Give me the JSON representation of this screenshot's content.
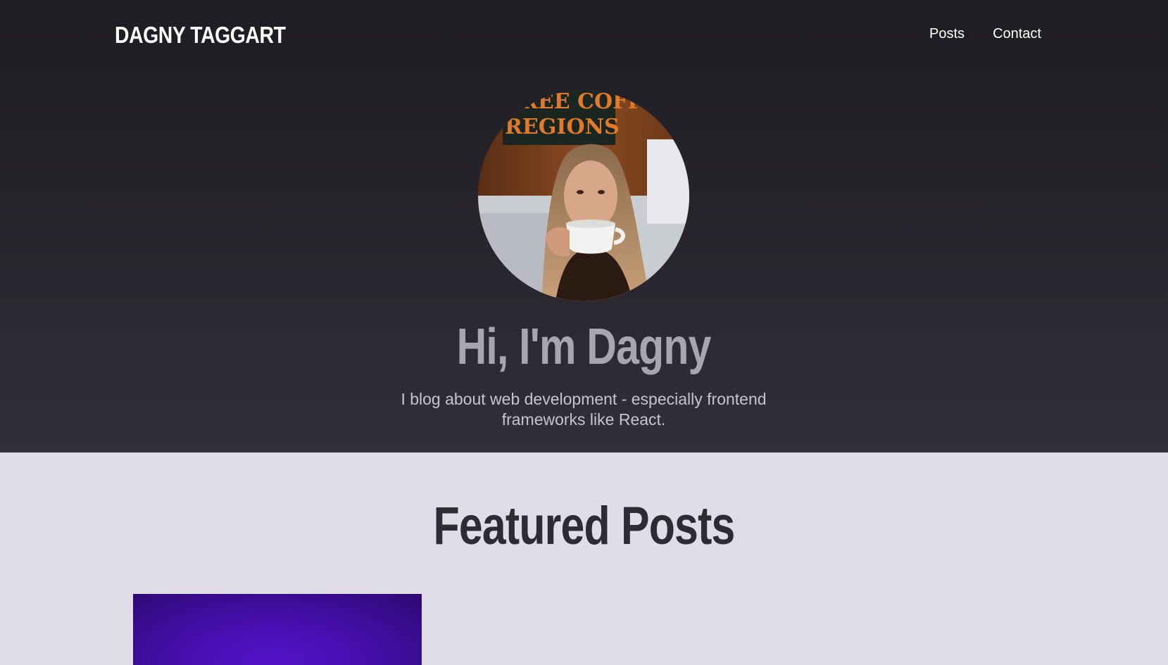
{
  "site": {
    "title": "DAGNY TAGGART"
  },
  "nav": {
    "items": [
      {
        "label": "Posts"
      },
      {
        "label": "Contact"
      }
    ]
  },
  "hero": {
    "heading": "Hi, I'm Dagny",
    "subtitle": "I blog about web development - especially frontend frameworks like React.",
    "avatar_sign_text": [
      "REE COFFEE",
      "REGIONS"
    ]
  },
  "featured": {
    "heading": "Featured Posts"
  },
  "colors": {
    "hero_bg_top": "#1f1d23",
    "hero_bg_bottom": "#332f39",
    "page_bg": "#e0dde8",
    "card_accent": "#4a0fb3"
  },
  "icons": {
    "avatar": "profile-photo"
  }
}
